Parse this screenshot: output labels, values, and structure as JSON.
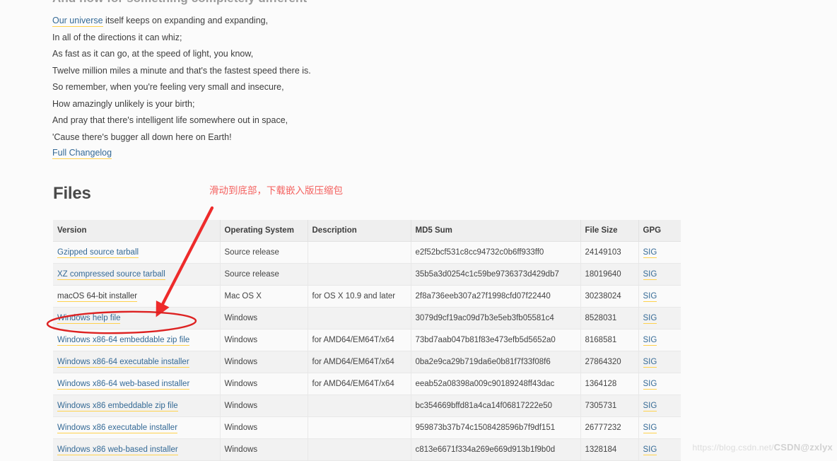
{
  "release": {
    "heading": "And now for something completely different",
    "poem_lines": [
      {
        "link": "Our universe",
        "rest": " itself keeps on expanding and expanding,"
      },
      {
        "link": "",
        "rest": "In all of the directions it can whiz;"
      },
      {
        "link": "",
        "rest": "As fast as it can go, at the speed of light, you know,"
      },
      {
        "link": "",
        "rest": "Twelve million miles a minute and that's the fastest speed there is."
      },
      {
        "link": "",
        "rest": "So remember, when you're feeling very small and insecure,"
      },
      {
        "link": "",
        "rest": "How amazingly unlikely is your birth;"
      },
      {
        "link": "",
        "rest": "And pray that there's intelligent life somewhere out in space,"
      },
      {
        "link": "",
        "rest": "'Cause there's bugger all down here on Earth!"
      }
    ],
    "changelog_label": "Full Changelog"
  },
  "files": {
    "heading": "Files",
    "columns": [
      "Version",
      "Operating System",
      "Description",
      "MD5 Sum",
      "File Size",
      "GPG"
    ],
    "rows": [
      {
        "version": "Gzipped source tarball",
        "is_link": true,
        "os": "Source release",
        "description": "",
        "md5": "e2f52bcf531c8cc94732c0b6ff933ff0",
        "size": "24149103",
        "gpg": "SIG"
      },
      {
        "version": "XZ compressed source tarball",
        "is_link": true,
        "os": "Source release",
        "description": "",
        "md5": "35b5a3d0254c1c59be9736373d429db7",
        "size": "18019640",
        "gpg": "SIG"
      },
      {
        "version": "macOS 64-bit installer",
        "is_link": false,
        "os": "Mac OS X",
        "description": "for OS X 10.9 and later",
        "md5": "2f8a736eeb307a27f1998cfd07f22440",
        "size": "30238024",
        "gpg": "SIG"
      },
      {
        "version": "Windows help file",
        "is_link": true,
        "os": "Windows",
        "description": "",
        "md5": "3079d9cf19ac09d7b3e5eb3fb05581c4",
        "size": "8528031",
        "gpg": "SIG"
      },
      {
        "version": "Windows x86-64 embeddable zip file",
        "is_link": true,
        "os": "Windows",
        "description": "for AMD64/EM64T/x64",
        "md5": "73bd7aab047b81f83e473efb5d5652a0",
        "size": "8168581",
        "gpg": "SIG"
      },
      {
        "version": "Windows x86-64 executable installer",
        "is_link": true,
        "os": "Windows",
        "description": "for AMD64/EM64T/x64",
        "md5": "0ba2e9ca29b719da6e0b81f7f33f08f6",
        "size": "27864320",
        "gpg": "SIG"
      },
      {
        "version": "Windows x86-64 web-based installer",
        "is_link": true,
        "os": "Windows",
        "description": "for AMD64/EM64T/x64",
        "md5": "eeab52a08398a009c90189248ff43dac",
        "size": "1364128",
        "gpg": "SIG"
      },
      {
        "version": "Windows x86 embeddable zip file",
        "is_link": true,
        "os": "Windows",
        "description": "",
        "md5": "bc354669bffd81a4ca14f06817222e50",
        "size": "7305731",
        "gpg": "SIG"
      },
      {
        "version": "Windows x86 executable installer",
        "is_link": true,
        "os": "Windows",
        "description": "",
        "md5": "959873b37b74c1508428596b7f9df151",
        "size": "26777232",
        "gpg": "SIG"
      },
      {
        "version": "Windows x86 web-based installer",
        "is_link": true,
        "os": "Windows",
        "description": "",
        "md5": "c813e6671f334a269e669d913b1f9b0d",
        "size": "1328184",
        "gpg": "SIG"
      }
    ]
  },
  "annotation": {
    "text": "滑动到底部，下载嵌入版压缩包",
    "color": "#f4615f",
    "highlight_target_row_index": 4
  },
  "watermark": {
    "url_text": "https://blog.csdn.net/",
    "brand": "CSDN",
    "handle": "@zxlyx"
  },
  "colors": {
    "link": "#356a96",
    "link_underline": "#ffd24d",
    "annotation_red": "#ee2b2b",
    "page_background": "#fbfbfb",
    "table_header_background": "#efefef"
  }
}
